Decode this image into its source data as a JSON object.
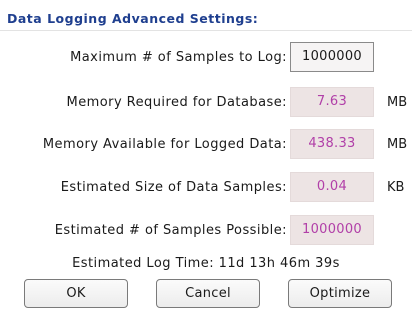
{
  "dialog": {
    "title": "Data Logging Advanced Settings:"
  },
  "rows": [
    {
      "label": "Maximum # of Samples to Log:",
      "value": "1000000",
      "editable": true,
      "unit": ""
    },
    {
      "label": "Memory Required for Database:",
      "value": "7.63",
      "editable": false,
      "unit": "MB"
    },
    {
      "label": "Memory Available for Logged Data:",
      "value": "438.33",
      "editable": false,
      "unit": "MB"
    },
    {
      "label": "Estimated Size of Data Samples:",
      "value": "0.04",
      "editable": false,
      "unit": "KB"
    },
    {
      "label": "Estimated # of Samples Possible:",
      "value": "1000000",
      "editable": false,
      "unit": ""
    }
  ],
  "status": {
    "log_time": "Estimated Log Time: 11d 13h 46m 39s"
  },
  "buttons": {
    "ok": "OK",
    "cancel": "Cancel",
    "optimize": "Optimize"
  },
  "colors": {
    "title": "#1f3f8f",
    "readonly_value": "#b13fa8",
    "readonly_bg": "#ede4e4"
  }
}
